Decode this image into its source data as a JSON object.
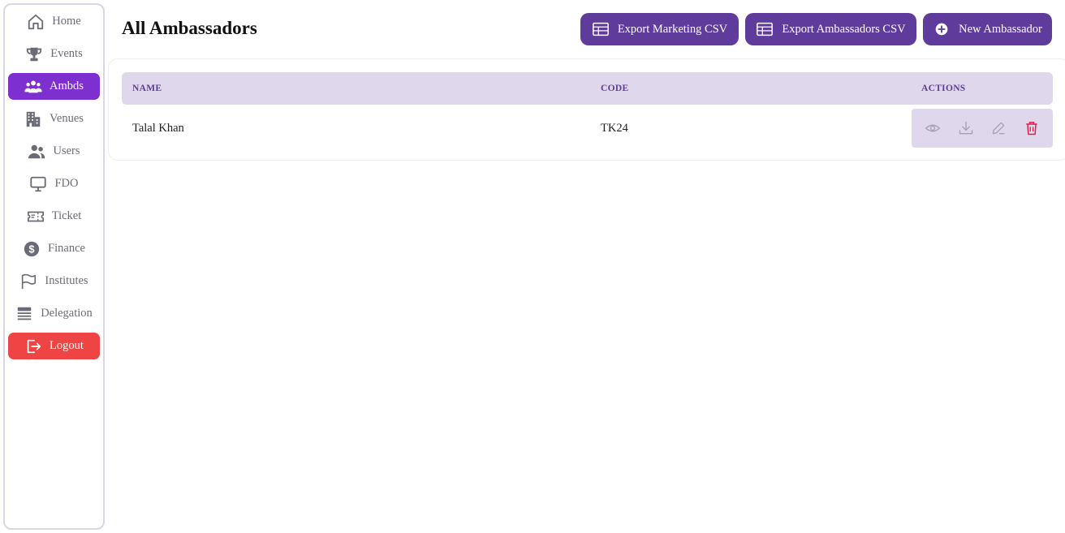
{
  "sidebar": {
    "items": [
      {
        "label": "Home",
        "icon": "home-icon"
      },
      {
        "label": "Events",
        "icon": "trophy-icon"
      },
      {
        "label": "Ambds",
        "icon": "users-group-icon",
        "active": true
      },
      {
        "label": "Venues",
        "icon": "building-icon"
      },
      {
        "label": "Users",
        "icon": "users-icon"
      },
      {
        "label": "FDO",
        "icon": "monitor-icon"
      },
      {
        "label": "Ticket",
        "icon": "ticket-icon"
      },
      {
        "label": "Finance",
        "icon": "dollar-icon"
      },
      {
        "label": "Institutes",
        "icon": "flag-icon"
      },
      {
        "label": "Delegation",
        "icon": "stack-icon"
      }
    ],
    "logout_label": "Logout"
  },
  "header": {
    "title": "All Ambassadors",
    "export_marketing_label": "Export Marketing CSV",
    "export_ambassadors_label": "Export Ambassadors CSV",
    "new_ambassador_label": "New Ambassador"
  },
  "table": {
    "columns": [
      "NAME",
      "CODE",
      "ACTIONS"
    ],
    "rows": [
      {
        "name": "Talal Khan",
        "code": "TK24"
      }
    ]
  },
  "colors": {
    "accent": "#7e2fd0",
    "button": "#5f3c9b",
    "header_bg": "#dfd7ec",
    "danger": "#ef4444",
    "delete_icon": "#e11d48"
  }
}
